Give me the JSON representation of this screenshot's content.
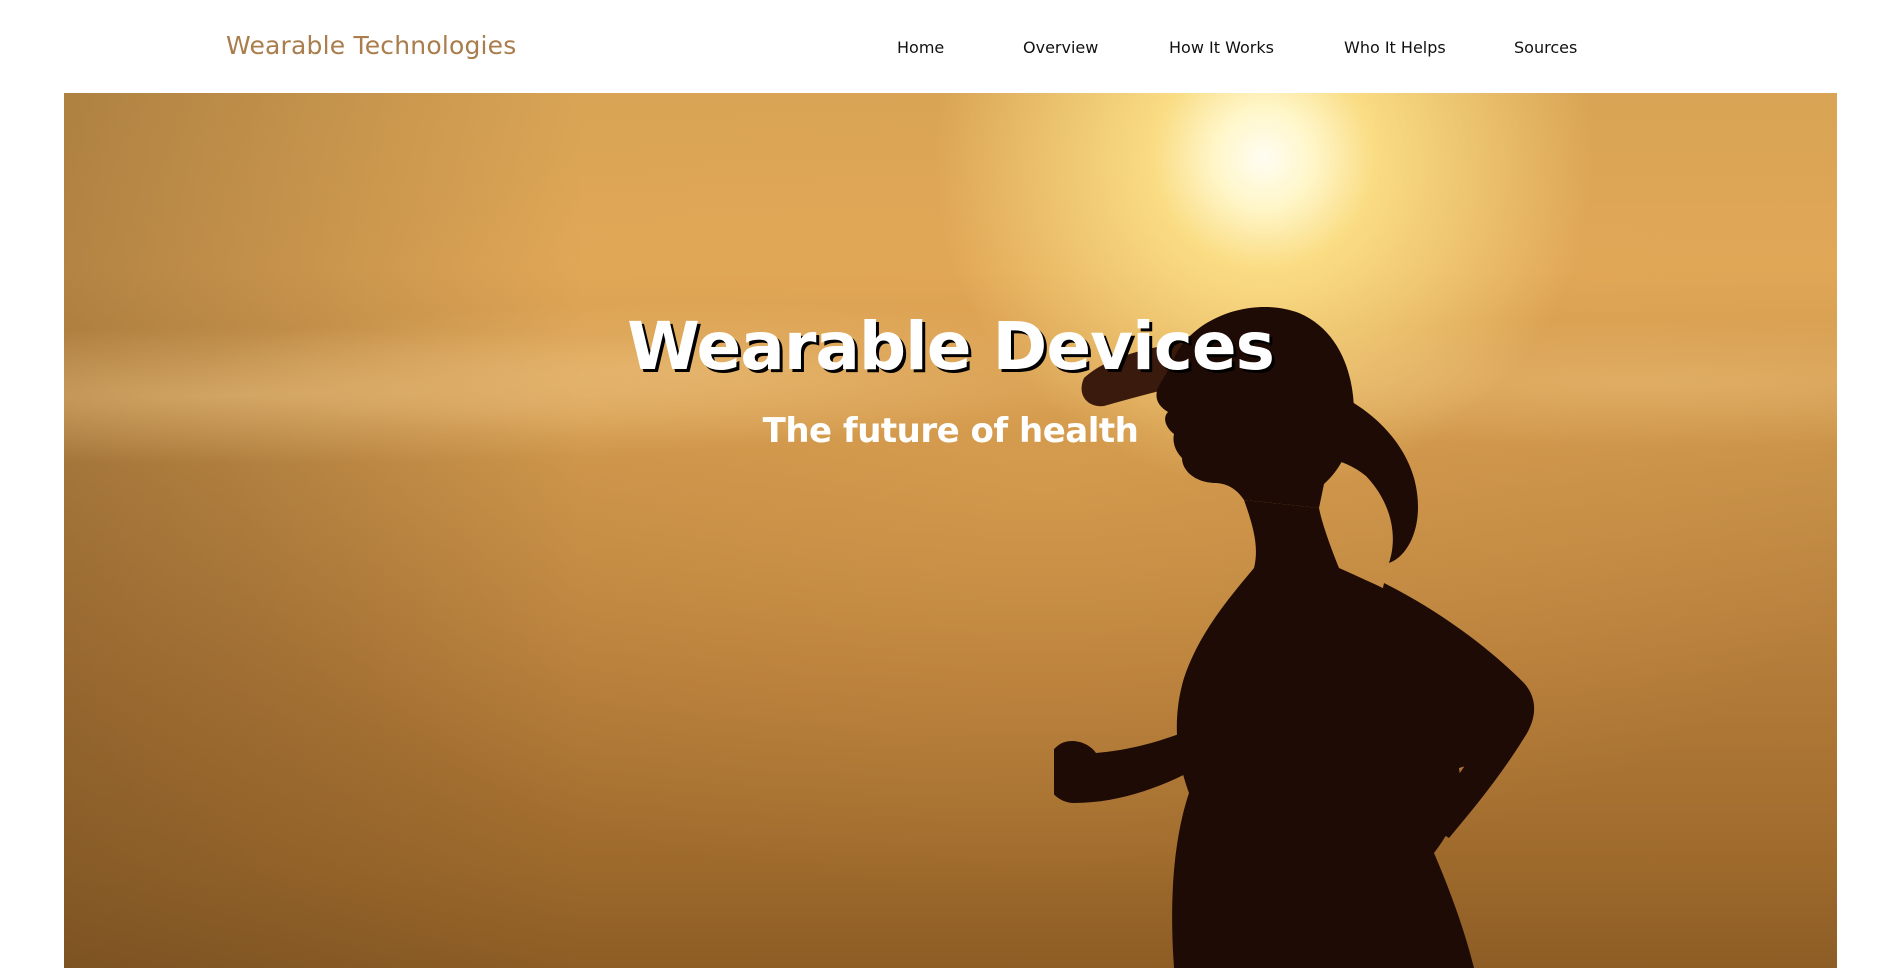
{
  "header": {
    "brand": "Wearable Technologies",
    "nav": [
      {
        "label": "Home"
      },
      {
        "label": "Overview"
      },
      {
        "label": "How It Works"
      },
      {
        "label": "Who It Helps"
      },
      {
        "label": "Sources"
      }
    ]
  },
  "hero": {
    "title": "Wearable Devices",
    "subtitle": "The future of health",
    "image": "runner-silhouette-at-sunset"
  },
  "colors": {
    "brand": "#a97d4c",
    "nav_text": "#111111",
    "hero_text": "#ffffff",
    "hero_sky": "#d9a455",
    "silhouette": "#1e0b05"
  }
}
